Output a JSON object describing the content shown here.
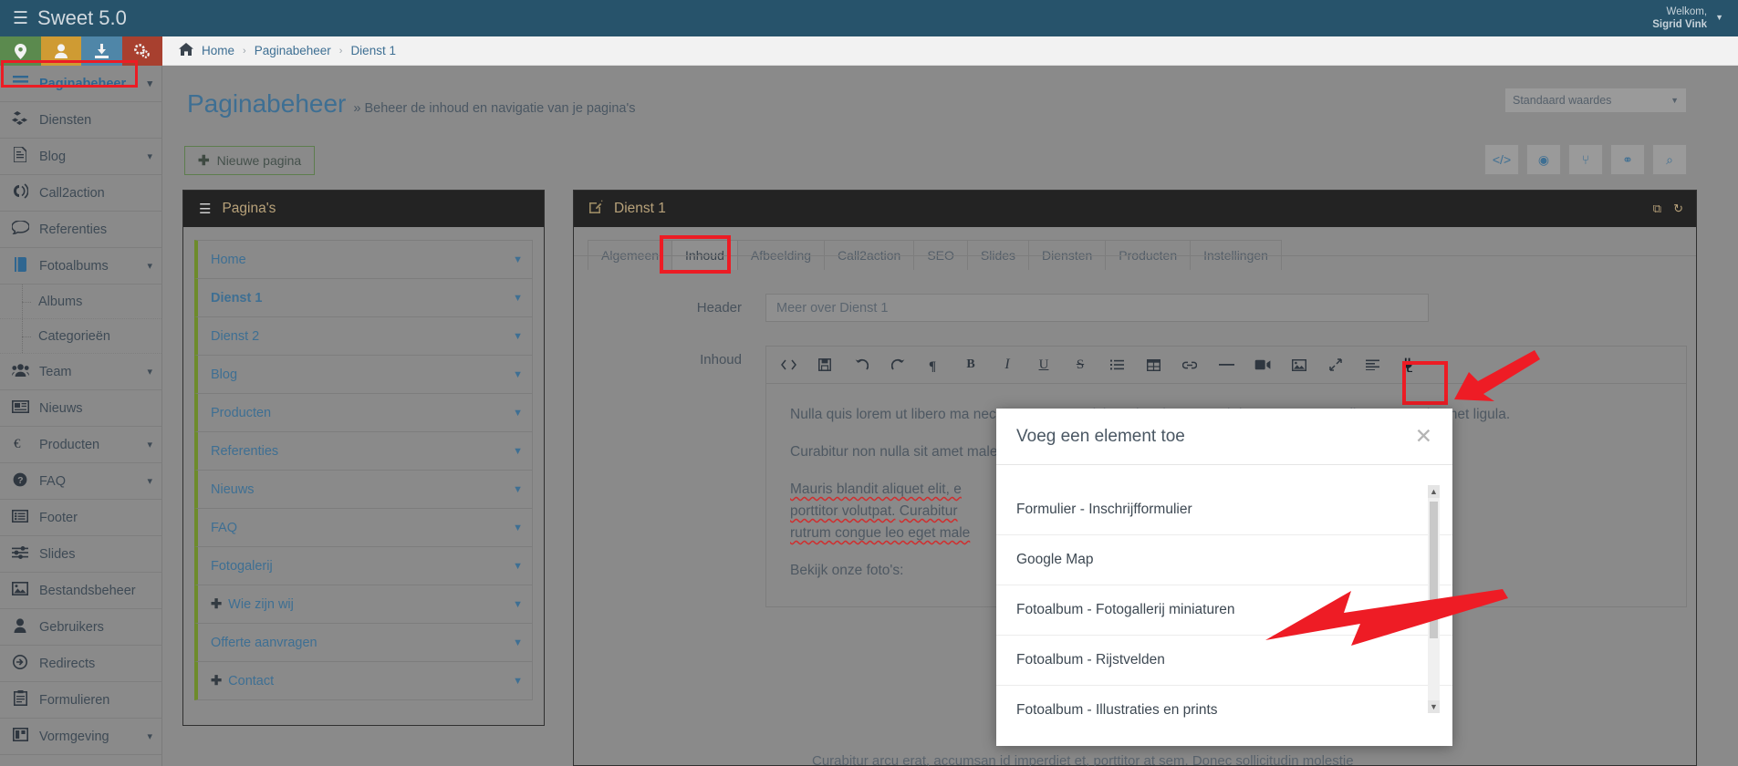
{
  "app": {
    "brand": "Sweet 5.0",
    "brand_icon": "server-icon",
    "welcome_line1": "Welkom,",
    "welcome_line2": "Sigrid Vink"
  },
  "quick_icons": [
    {
      "name": "location-pin-icon",
      "glyph": "⬤",
      "color": "#5b8a4e"
    },
    {
      "name": "user-icon",
      "glyph": "●",
      "color": "#cf9b33"
    },
    {
      "name": "download-icon",
      "glyph": "⬇",
      "color": "#4f86a8"
    },
    {
      "name": "settings-gears-icon",
      "glyph": "⚙",
      "color": "#a8402f"
    }
  ],
  "breadcrumb": {
    "home_icon": "home-icon",
    "items": [
      "Home",
      "Paginabeheer",
      "Dienst 1"
    ],
    "separator": "›"
  },
  "page": {
    "title": "Paginabeheer",
    "subtitle": "» Beheer de inhoud en navigatie van je pagina's",
    "preset_select": "Standaard waardes",
    "new_page_button": "Nieuwe pagina"
  },
  "right_tools": [
    {
      "name": "source-code-icon",
      "glyph": "</>"
    },
    {
      "name": "preview-eye-icon",
      "glyph": "◉"
    },
    {
      "name": "share-icon",
      "glyph": "⑂"
    },
    {
      "name": "sitemap-icon",
      "glyph": "⚭"
    },
    {
      "name": "search-icon",
      "glyph": "⌕"
    }
  ],
  "sidebar": {
    "items": [
      {
        "label": "Paginabeheer",
        "icon": "hamburger-icon",
        "glyph": "☰",
        "active": true,
        "caret": true,
        "sub": []
      },
      {
        "label": "Diensten",
        "icon": "cubes-icon",
        "glyph": "❖",
        "active": false,
        "caret": false,
        "sub": []
      },
      {
        "label": "Blog",
        "icon": "document-icon",
        "glyph": "Ὄ4",
        "active": false,
        "caret": true,
        "sub": []
      },
      {
        "label": "Call2action",
        "icon": "megaphone-icon",
        "glyph": "☎",
        "active": false,
        "caret": false,
        "sub": []
      },
      {
        "label": "Referenties",
        "icon": "comment-icon",
        "glyph": "὞9",
        "active": false,
        "caret": false,
        "sub": []
      },
      {
        "label": "Fotoalbums",
        "icon": "book-icon",
        "glyph": "Ὅ8",
        "active": false,
        "caret": true,
        "sub": [
          "Albums",
          "Categorieën"
        ]
      },
      {
        "label": "Team",
        "icon": "users-icon",
        "glyph": "὆5",
        "active": false,
        "caret": true,
        "sub": []
      },
      {
        "label": "Nieuws",
        "icon": "newspaper-icon",
        "glyph": "὏0",
        "active": false,
        "caret": false,
        "sub": []
      },
      {
        "label": "Producten",
        "icon": "euro-icon",
        "glyph": "€",
        "active": false,
        "caret": true,
        "sub": []
      },
      {
        "label": "FAQ",
        "icon": "question-circle-icon",
        "glyph": "?",
        "active": false,
        "caret": true,
        "sub": []
      },
      {
        "label": "Footer",
        "icon": "list-box-icon",
        "glyph": "≣",
        "active": false,
        "caret": false,
        "sub": []
      },
      {
        "label": "Slides",
        "icon": "sliders-icon",
        "glyph": "☲",
        "active": false,
        "caret": false,
        "sub": []
      },
      {
        "label": "Bestandsbeheer",
        "icon": "image-icon",
        "glyph": "Ὓc",
        "active": false,
        "caret": false,
        "sub": []
      },
      {
        "label": "Gebruikers",
        "icon": "user-icon",
        "glyph": "●",
        "active": false,
        "caret": false,
        "sub": []
      },
      {
        "label": "Redirects",
        "icon": "arrow-circle-right-icon",
        "glyph": "→",
        "active": false,
        "caret": false,
        "sub": []
      },
      {
        "label": "Formulieren",
        "icon": "clipboard-icon",
        "glyph": "Ὄb",
        "active": false,
        "caret": false,
        "sub": []
      },
      {
        "label": "Vormgeving",
        "icon": "layout-icon",
        "glyph": "◫",
        "active": false,
        "caret": true,
        "sub": []
      }
    ]
  },
  "pages_panel": {
    "header": "Pagina's",
    "header_icon": "hamburger-icon",
    "rows": [
      {
        "label": "Home",
        "bold": false,
        "plus": false
      },
      {
        "label": "Dienst 1",
        "bold": true,
        "plus": false
      },
      {
        "label": "Dienst 2",
        "bold": false,
        "plus": false
      },
      {
        "label": "Blog",
        "bold": false,
        "plus": false
      },
      {
        "label": "Producten",
        "bold": false,
        "plus": false
      },
      {
        "label": "Referenties",
        "bold": false,
        "plus": false
      },
      {
        "label": "Nieuws",
        "bold": false,
        "plus": false
      },
      {
        "label": "FAQ",
        "bold": false,
        "plus": false
      },
      {
        "label": "Fotogalerij",
        "bold": false,
        "plus": false
      },
      {
        "label": "Wie zijn wij",
        "bold": false,
        "plus": true
      },
      {
        "label": "Offerte aanvragen",
        "bold": false,
        "plus": false
      },
      {
        "label": "Contact",
        "bold": false,
        "plus": true
      }
    ]
  },
  "content_panel": {
    "header": "Dienst 1",
    "header_icon": "edit-square-icon",
    "tools": [
      {
        "name": "expand-icon",
        "glyph": "⤡"
      },
      {
        "name": "refresh-icon",
        "glyph": "↻"
      }
    ],
    "tabs": [
      {
        "label": "Algemeen",
        "active": false
      },
      {
        "label": "Inhoud",
        "active": true
      },
      {
        "label": "Afbeelding",
        "active": false
      },
      {
        "label": "Call2action",
        "active": false
      },
      {
        "label": "SEO",
        "active": false
      },
      {
        "label": "Slides",
        "active": false
      },
      {
        "label": "Diensten",
        "active": false
      },
      {
        "label": "Producten",
        "active": false
      },
      {
        "label": "Instellingen",
        "active": false
      }
    ],
    "form": {
      "header_label": "Header",
      "header_value": "Meer over Dienst 1",
      "inhoud_label": "Inhoud"
    },
    "editor_toolbar": [
      {
        "name": "source-code-icon",
        "glyph": "<>"
      },
      {
        "name": "save-disk-icon",
        "glyph": "Ὃe"
      },
      {
        "name": "undo-icon",
        "glyph": "↺"
      },
      {
        "name": "redo-icon",
        "glyph": "↻"
      },
      {
        "name": "paragraph-icon",
        "glyph": "¶"
      },
      {
        "name": "bold-icon",
        "glyph": "B"
      },
      {
        "name": "italic-icon",
        "glyph": "I"
      },
      {
        "name": "underline-icon",
        "glyph": "U"
      },
      {
        "name": "strikethrough-icon",
        "glyph": "S"
      },
      {
        "name": "bullet-list-icon",
        "glyph": "☰"
      },
      {
        "name": "table-icon",
        "glyph": "⊞"
      },
      {
        "name": "link-icon",
        "glyph": "ὑ7"
      },
      {
        "name": "horizontal-rule-icon",
        "glyph": "—"
      },
      {
        "name": "video-icon",
        "glyph": "▶"
      },
      {
        "name": "image-icon",
        "glyph": "Ὓc"
      },
      {
        "name": "fullscreen-icon",
        "glyph": "⤡"
      },
      {
        "name": "align-left-icon",
        "glyph": "≡"
      },
      {
        "name": "plugin-plug-icon",
        "glyph": "ὐc",
        "highlighted": true
      }
    ],
    "editor_body": {
      "p1": "Nulla quis lorem ut libero ma nec, egestas non nisi. Sed po luctus et ultrices posuere cu ullamcorper sit amet ligula.",
      "p2": "Curabitur non nulla sit amet malesuada. Vivamus magna j sapien massa, convallis a pel",
      "p3_a": "Mauris blandit aliquet elit, e",
      "p3_b": "porttitor volutpat.",
      "p3_c": "Curabitur",
      "p3_d": "rutrum congue leo eget male",
      "p4": "Bekijk onze foto's:",
      "p5": "Curabitur arcu erat, accumsan id imperdiet et, porttitor at sem. Donec sollicitudin molestie"
    }
  },
  "modal": {
    "title": "Voeg een element toe",
    "close_icon": "close-icon",
    "items": [
      "Formulier - Inschrijfformulier",
      "Google Map",
      "Fotoalbum - Fotogallerij miniaturen",
      "Fotoalbum - Rijstvelden",
      "Fotoalbum - Illustraties en prints"
    ],
    "scroll_up_icon": "triangle-up-icon",
    "scroll_down_icon": "triangle-down-icon"
  },
  "annotations": {
    "highlight_color": "#ec1c24",
    "arrow_to_plugin": "plugin-plug-icon",
    "arrow_to_item": "Fotoalbum - Fotogallerij miniaturen"
  }
}
